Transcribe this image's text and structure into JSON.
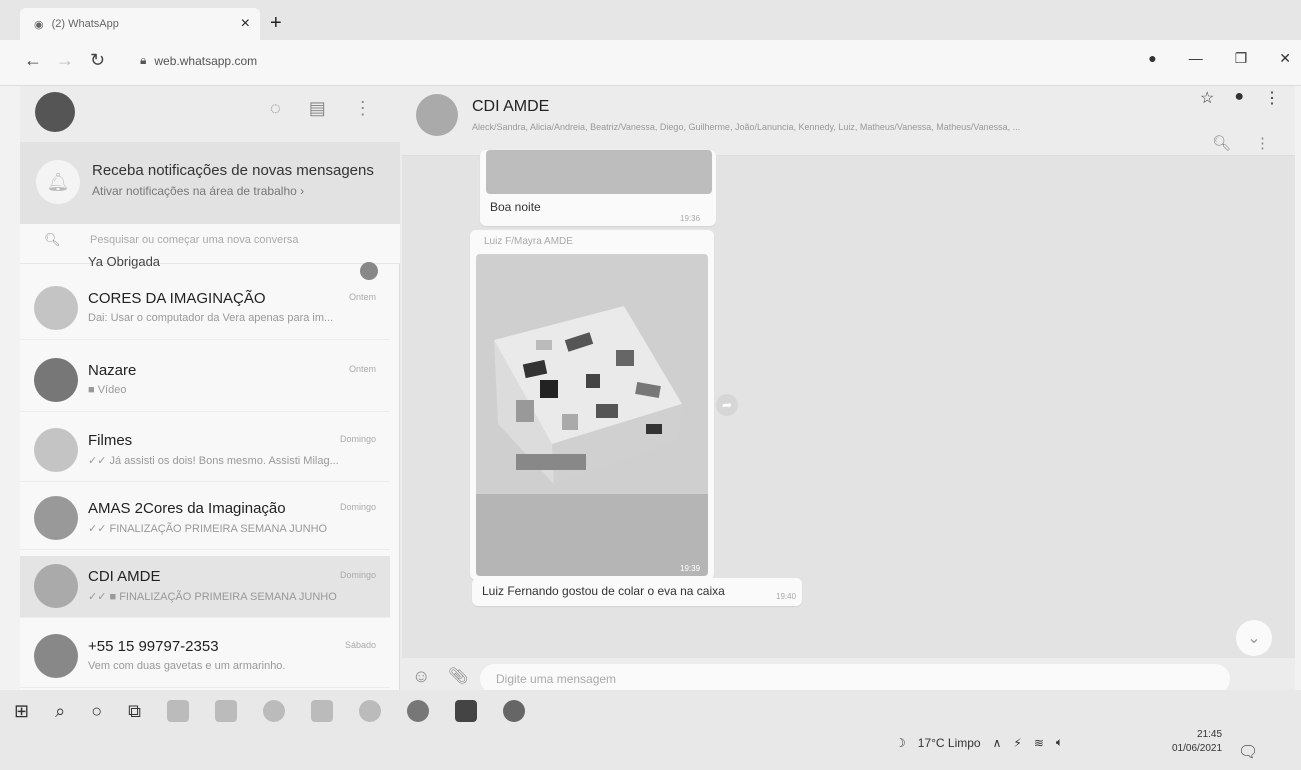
{
  "browser": {
    "tab_title": "(2) WhatsApp",
    "tab_close": "×",
    "new_tab": "+",
    "url": "web.whatsapp.com"
  },
  "notification": {
    "title": "Receba notificações de novas mensagens",
    "subtitle": "Ativar notificações na área de trabalho ›"
  },
  "search": {
    "placeholder": "Pesquisar ou começar uma nova conversa"
  },
  "chats": {
    "partial": {
      "name": "Ya Obrigada"
    },
    "items": [
      {
        "name": "CORES DA IMAGINAÇÃO",
        "last": "Dai: Usar o computador da Vera apenas para im...",
        "time": "Ontem"
      },
      {
        "name": "Nazare",
        "last": "■ Vídeo",
        "time": "Ontem"
      },
      {
        "name": "Filmes",
        "last": "✓✓ Já assisti os dois! Bons mesmo. Assisti Milag...",
        "time": "Domingo"
      },
      {
        "name": "AMAS 2Cores da Imaginação",
        "last": "✓✓ FINALIZAÇÃO PRIMEIRA SEMANA JUNHO",
        "time": "Domingo"
      },
      {
        "name": "CDI AMDE",
        "last": "✓✓ ■ FINALIZAÇÃO PRIMEIRA SEMANA JUNHO",
        "time": "Domingo"
      },
      {
        "name": "+55 15 99797-2353",
        "last": "Vem com duas gavetas e um armarinho.",
        "time": "Sábado"
      }
    ]
  },
  "conversation": {
    "title": "CDI AMDE",
    "members": "Aleck/Sandra, Alicia/Andreia, Beatriz/Vanessa, Diego, Guilherme, João/Lanuncia, Kennedy, Luiz, Matheus/Vanessa, Matheus/Vanessa, ...",
    "messages": [
      {
        "text": "Boa noite",
        "time": "19:36"
      },
      {
        "sender": "Luiz F/Mayra AMDE",
        "time": "19:39"
      },
      {
        "text": "Luiz Fernando gostou de colar o eva na caixa",
        "time": "19:40"
      }
    ],
    "compose_placeholder": "Digite uma mensagem"
  },
  "taskbar": {
    "weather": "17°C  Limpo",
    "time": "21:45",
    "date": "01/06/2021"
  }
}
